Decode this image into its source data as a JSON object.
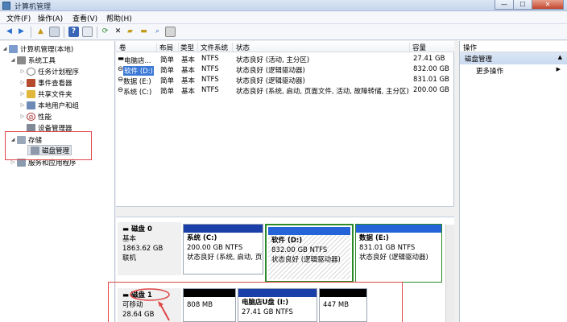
{
  "window": {
    "title": "计算机管理",
    "buttons": {
      "minimize": "—",
      "maximize": "☐",
      "close": "✕"
    }
  },
  "menu": [
    "文件(F)",
    "操作(A)",
    "查看(V)",
    "帮助(H)"
  ],
  "toolbar_icons": [
    "back-icon",
    "forward-icon",
    "up-folder-icon",
    "show-tree-icon",
    "help-icon",
    "properties-icon",
    "refresh-icon",
    "delete-icon",
    "open-icon",
    "save-icon",
    "search-icon"
  ],
  "tree": {
    "root": "计算机管理(本地)",
    "system_tools": "系统工具",
    "task_scheduler": "任务计划程序",
    "event_viewer": "事件查看器",
    "shared_folders": "共享文件夹",
    "local_users": "本地用户和组",
    "performance": "性能",
    "device_manager": "设备管理器",
    "storage": "存储",
    "disk_management": "磁盘管理",
    "services": "服务和应用程序"
  },
  "volume_table": {
    "headers": [
      "卷",
      "布局",
      "类型",
      "文件系统",
      "状态",
      "容量"
    ],
    "rows": [
      {
        "vol": "电脑店...",
        "layout": "简单",
        "type": "基本",
        "fs": "NTFS",
        "status": "状态良好 (活动, 主分区)",
        "cap": "27.41 GB"
      },
      {
        "vol": "软件 (D:)",
        "layout": "简单",
        "type": "基本",
        "fs": "NTFS",
        "status": "状态良好 (逻辑驱动器)",
        "cap": "832.00 GB"
      },
      {
        "vol": "数据 (E:)",
        "layout": "简单",
        "type": "基本",
        "fs": "NTFS",
        "status": "状态良好 (逻辑驱动器)",
        "cap": "831.01 GB"
      },
      {
        "vol": "系统 (C:)",
        "layout": "简单",
        "type": "基本",
        "fs": "NTFS",
        "status": "状态良好 (系统, 启动, 页面文件, 活动, 故障转储, 主分区)",
        "cap": "200.00 GB"
      }
    ]
  },
  "actions": {
    "header": "操作",
    "section": "磁盘管理",
    "more": "更多操作"
  },
  "disk0": {
    "name": "磁盘 0",
    "type": "基本",
    "size": "1863.62 GB",
    "status": "联机",
    "parts": [
      {
        "name": "系统 (C:)",
        "size": "200.00 GB NTFS",
        "status": "状态良好 (系统, 启动, 页"
      },
      {
        "name": "软件 (D:)",
        "size": "832.00 GB NTFS",
        "status": "状态良好 (逻辑驱动器)"
      },
      {
        "name": "数据 (E:)",
        "size": "831.01 GB NTFS",
        "status": "状态良好 (逻辑驱动器)"
      }
    ]
  },
  "disk1": {
    "name": "磁盘 1",
    "type": "可移动",
    "size": "28.64 GB",
    "parts": [
      {
        "name": "",
        "size": "808 MB"
      },
      {
        "name": "电脑店U盘 (I:)",
        "size": "27.41 GB NTFS"
      },
      {
        "name": "",
        "size": "447 MB"
      }
    ]
  },
  "colors": {
    "primary_partition": "#1a3fa8",
    "logical_drive": "#2563d9",
    "unallocated": "#000000",
    "selected_border": "#2a8a2a",
    "annotation_red": "#e04545"
  }
}
